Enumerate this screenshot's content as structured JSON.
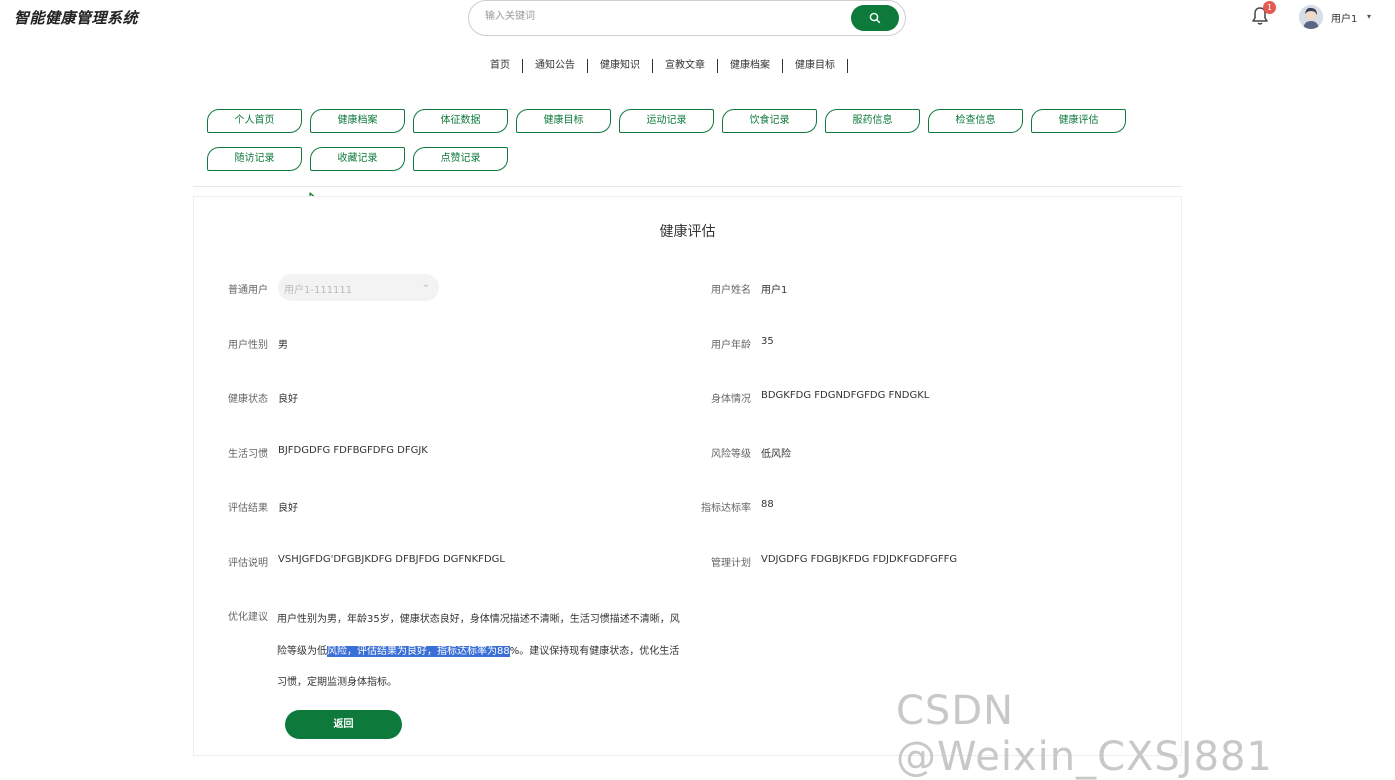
{
  "header": {
    "logo": "智能健康管理系统",
    "search_placeholder": "输入关键词",
    "notification_count": "1",
    "user_name": "用户1",
    "user_caret": "▾"
  },
  "nav": {
    "items": [
      "首页",
      "通知公告",
      "健康知识",
      "宣教文章",
      "健康档案",
      "健康目标"
    ]
  },
  "tabs": {
    "row1": [
      "个人首页",
      "健康档案",
      "体征数据",
      "健康目标",
      "运动记录",
      "饮食记录",
      "服药信息",
      "检查信息",
      "健康评估"
    ],
    "row2": [
      "随访记录",
      "收藏记录",
      "点赞记录"
    ]
  },
  "form": {
    "title": "健康评估",
    "user_select_label": "普通用户",
    "user_select_value": "用户1-111111",
    "user_name_label": "用户姓名",
    "user_name_value": "用户1",
    "gender_label": "用户性别",
    "gender_value": "男",
    "age_label": "用户年龄",
    "age_value": "35",
    "health_status_label": "健康状态",
    "health_status_value": "良好",
    "body_label": "身体情况",
    "body_value": "BDGKFDG FDGNDFGFDG FNDGKL",
    "habit_label": "生活习惯",
    "habit_value": "BJFDGDFG FDFBGFDFG DFGJK",
    "risk_label": "风险等级",
    "risk_value": "低风险",
    "result_label": "评估结果",
    "result_value": "良好",
    "rate_label": "指标达标率",
    "rate_value": "88",
    "desc_label": "评估说明",
    "desc_value": "VSHJGFDG'DFGBJKDFG DFBJFDG DGFNKFDGL",
    "plan_label": "管理计划",
    "plan_value": "VDJGDFG FDGBJKFDG FDJDKFGDFGFFG",
    "advice_label": "优化建议",
    "advice_part1": "用户性别为男，年龄35岁，健康状态良好，身体情况描述不清晰，生活习惯描述不清晰，风险等级为低",
    "advice_highlight": "风险，评估结果为良好，指标达标率为88",
    "advice_part2": "%。建议保持现有健康状态，优化生活习惯，定期监测身体指标。",
    "back_label": "返回"
  },
  "watermark": "CSDN @Weixin_CXSJ881",
  "colors": {
    "primary": "#0d7a3b",
    "highlight": "#3a6fd6",
    "badge": "#e45a4f"
  }
}
